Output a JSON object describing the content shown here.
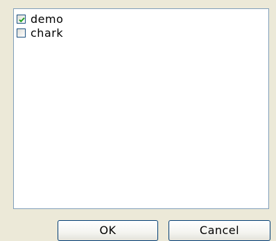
{
  "list": {
    "items": [
      {
        "label": "demo",
        "checked": true
      },
      {
        "label": "chark",
        "checked": false
      }
    ]
  },
  "buttons": {
    "ok_label": "OK",
    "cancel_label": "Cancel"
  },
  "colors": {
    "dialog_background": "#ece9d8",
    "list_border": "#7f9db9",
    "checkbox_border": "#1c5180",
    "check_mark": "#21a121",
    "button_border": "#003c74"
  }
}
